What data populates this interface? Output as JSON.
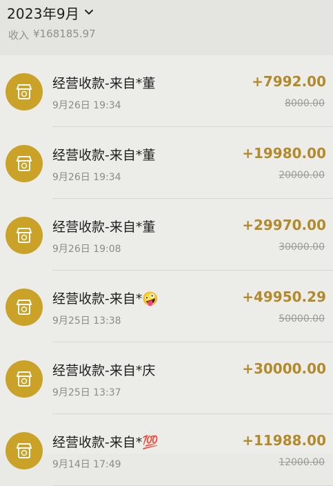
{
  "header": {
    "month": "2023年9月",
    "income_label": "收入",
    "income_value": "¥168185.97"
  },
  "transactions": [
    {
      "title": "经营收款-来自*董",
      "time": "9月26日 19:34",
      "amount": "+7992.00",
      "original": "8000.00"
    },
    {
      "title": "经营收款-来自*董",
      "time": "9月26日 19:34",
      "amount": "+19980.00",
      "original": "20000.00"
    },
    {
      "title": "经营收款-来自*董",
      "time": "9月26日 19:08",
      "amount": "+29970.00",
      "original": "30000.00"
    },
    {
      "title": "经营收款-来自*🤪",
      "time": "9月25日 13:38",
      "amount": "+49950.29",
      "original": "50000.00"
    },
    {
      "title": "经营收款-来自*庆",
      "time": "9月25日 13:37",
      "amount": "+30000.00",
      "original": ""
    },
    {
      "title": "经营收款-来自*💯",
      "time": "9月14日 17:49",
      "amount": "+11988.00",
      "original": "12000.00"
    }
  ],
  "colors": {
    "accent": "#b28a2c",
    "avatar_bg": "#c9a227"
  },
  "icons": {
    "month_toggle": "chevron-down-icon",
    "avatar": "store-icon"
  }
}
